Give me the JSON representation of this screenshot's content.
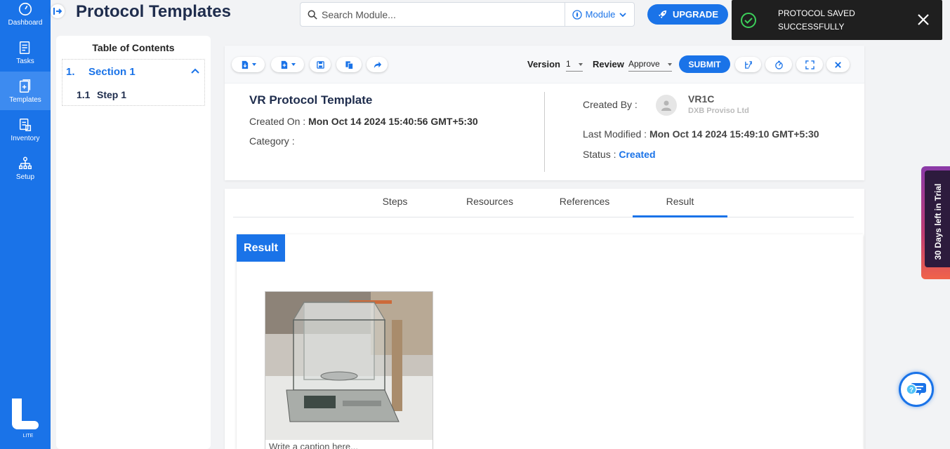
{
  "nav": {
    "items": [
      {
        "label": "Dashboard",
        "icon": "gauge-icon"
      },
      {
        "label": "Tasks",
        "icon": "tasks-icon"
      },
      {
        "label": "Templates",
        "icon": "templates-icon",
        "active": true
      },
      {
        "label": "Inventory",
        "icon": "inventory-icon"
      },
      {
        "label": "Setup",
        "icon": "setup-icon"
      }
    ],
    "logo_text": "LITE"
  },
  "header": {
    "title": "Protocol Templates",
    "search_placeholder": "Search Module...",
    "module_label": "Module",
    "upgrade_label": "UPGRADE"
  },
  "toast": {
    "message": "PROTOCOL SAVED SUCCESSFULLY"
  },
  "toc": {
    "title": "Table of Contents",
    "section_num": "1.",
    "section_label": "Section 1",
    "step_num": "1.1",
    "step_label": "Step 1"
  },
  "toolbar": {
    "version_label": "Version",
    "version_value": "1",
    "review_label": "Review",
    "review_value": "Approve",
    "submit_label": "SUBMIT"
  },
  "protocol": {
    "title": "VR Protocol Template",
    "created_on_label": "Created On :",
    "created_on_value": "Mon Oct 14 2024 15:40:56 GMT+5:30",
    "category_label": "Category :",
    "created_by_label": "Created By :",
    "user_name": "VR1C",
    "user_org": "DXB Proviso Ltd",
    "last_modified_label": "Last Modified :",
    "last_modified_value": "Mon Oct 14 2024 15:49:10 GMT+5:30",
    "status_label": "Status :",
    "status_value": "Created"
  },
  "tabs": [
    {
      "label": "Steps"
    },
    {
      "label": "Resources"
    },
    {
      "label": "References"
    },
    {
      "label": "Result",
      "active": true
    }
  ],
  "result": {
    "heading": "Result",
    "caption": "Write a caption here..."
  },
  "trial": {
    "label": "30 Days left in Trial"
  },
  "colors": {
    "primary": "#1a73e8",
    "sidebar": "#1a73e8",
    "toast_bg": "#1f1f1f",
    "status": "#1a73e8"
  }
}
